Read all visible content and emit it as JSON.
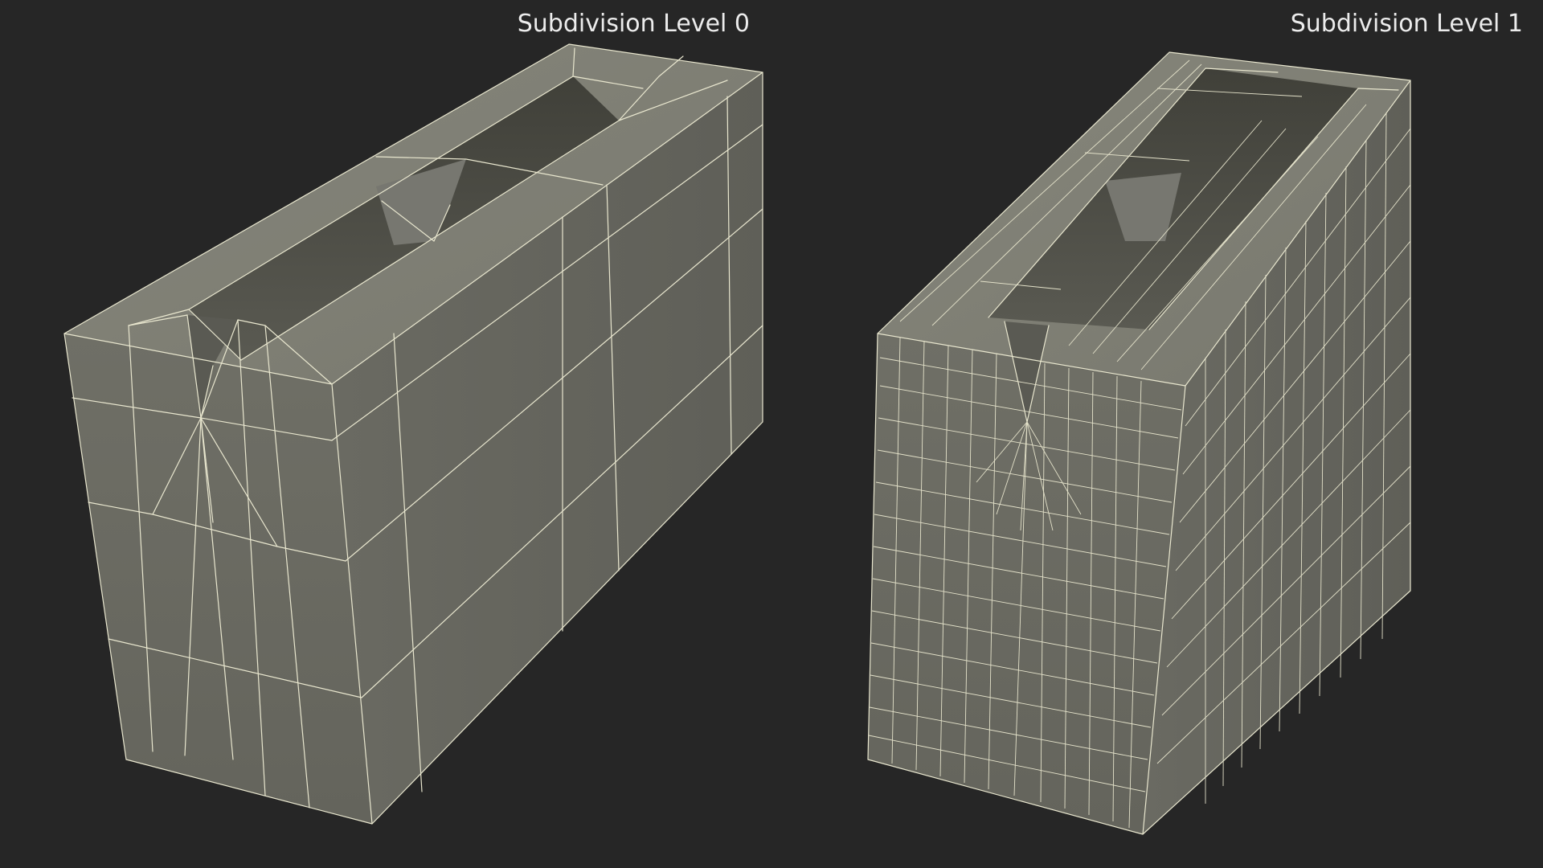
{
  "labels": {
    "left": "Subdivision Level 0",
    "right": "Subdivision Level 1"
  },
  "colors": {
    "background": "#262626",
    "model_front": "#6c6c63",
    "model_side": "#65655d",
    "model_top": "#7e7e74",
    "inner_cavity": "#4a4b45",
    "wireframe": "#e9e7cf"
  }
}
